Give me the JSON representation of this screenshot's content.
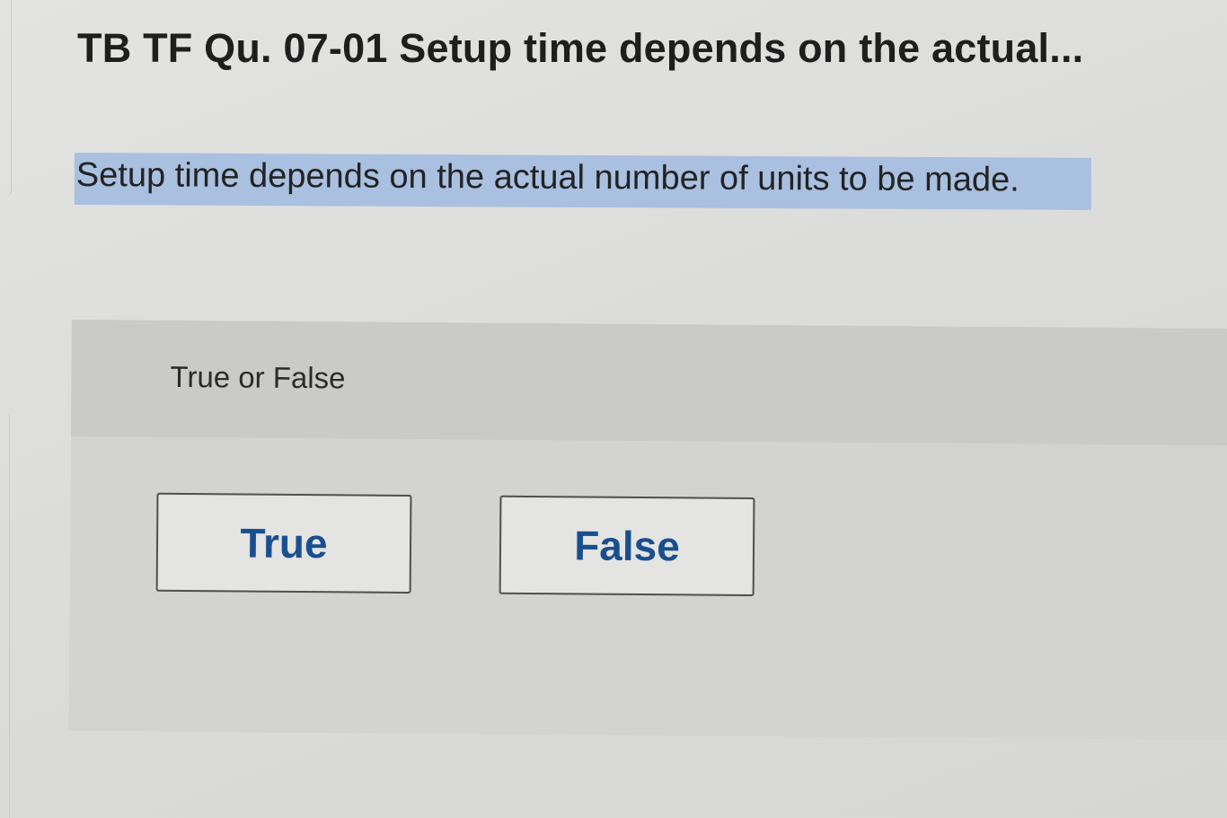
{
  "question": {
    "title": "TB TF Qu. 07-01 Setup time depends on the actual...",
    "prompt": "Setup time depends on the actual number of units to be made."
  },
  "answer_panel": {
    "label": "True or False",
    "options": [
      "True",
      "False"
    ]
  },
  "colors": {
    "highlight": "#a9c0e0",
    "option_text": "#1a4f8f"
  }
}
